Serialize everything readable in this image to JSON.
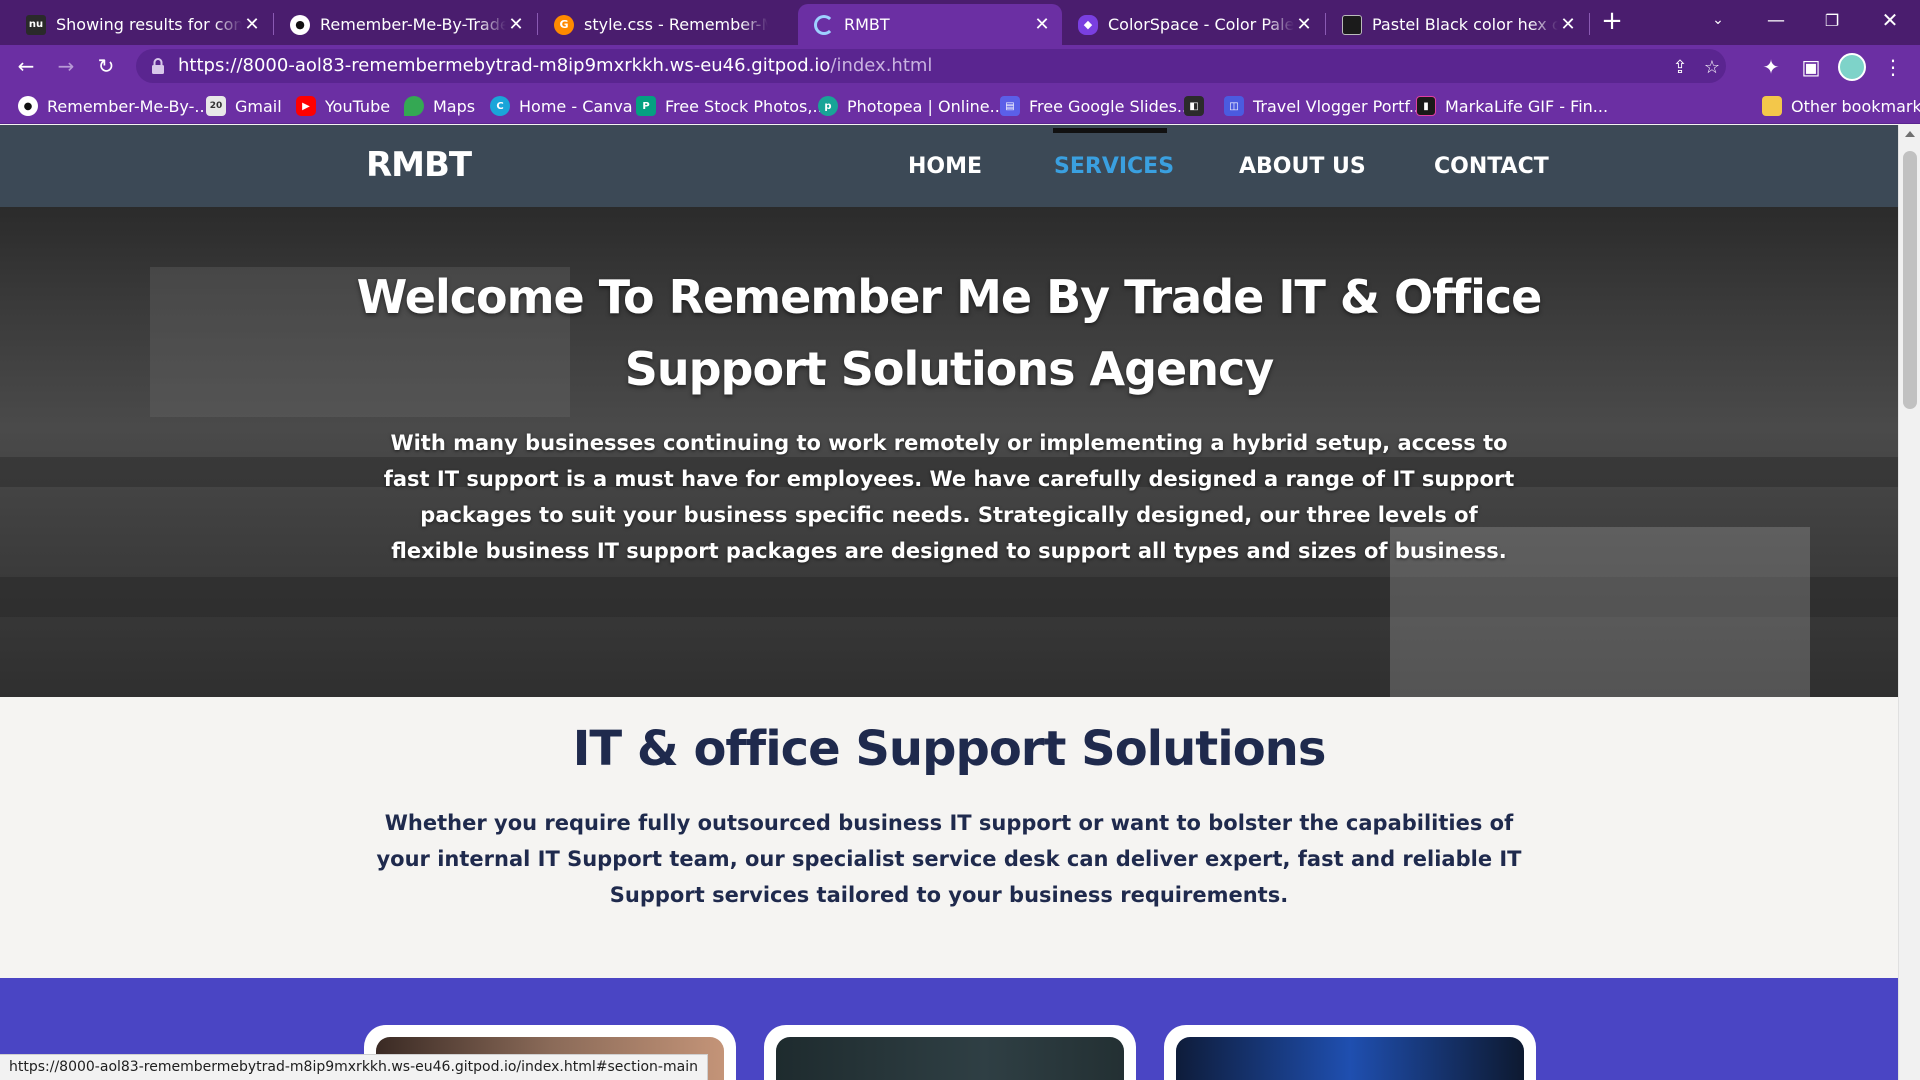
{
  "browser": {
    "tabs": [
      {
        "title": "Showing results for content",
        "favicon": "nu"
      },
      {
        "title": "Remember-Me-By-Trade/index",
        "favicon": "github-icon"
      },
      {
        "title": "style.css - Remember-Me-By",
        "favicon": "gitpod-icon"
      },
      {
        "title": "RMBT",
        "favicon": "loading-icon"
      },
      {
        "title": "ColorSpace - Color Palettes",
        "favicon": "colorspace-icon"
      },
      {
        "title": "Pastel Black color hex code",
        "favicon": "colorhex-icon"
      }
    ],
    "active_tab_index": 3,
    "url_host": "https://8000-aol83-remembermebytrad-m8ip9mxrkkh.ws-eu46.gitpod.io",
    "url_path": "/index.html",
    "bookmarks": [
      {
        "label": "Remember-Me-By-...",
        "icon": "github-icon"
      },
      {
        "label": "Gmail",
        "icon": "calendar-icon"
      },
      {
        "label": "YouTube",
        "icon": "youtube-icon"
      },
      {
        "label": "Maps",
        "icon": "maps-icon"
      },
      {
        "label": "Home - Canva",
        "icon": "canva-icon"
      },
      {
        "label": "Free Stock Photos,...",
        "icon": "stock-photos-icon"
      },
      {
        "label": "Photopea | Online...",
        "icon": "photopea-icon"
      },
      {
        "label": "Free Google Slides...",
        "icon": "slides-icon"
      },
      {
        "label": "",
        "icon": "bookmark-cube-icon"
      },
      {
        "label": "Travel Vlogger Portf...",
        "icon": "portfolio-icon"
      },
      {
        "label": "MarkaLife GIF - Fin...",
        "icon": "gif-icon"
      }
    ],
    "other_bookmarks": "Other bookmarks",
    "status_url": "https://8000-aol83-remembermebytrad-m8ip9mxrkkh.ws-eu46.gitpod.io/index.html#section-main"
  },
  "site": {
    "logo": "RMBT",
    "nav": [
      {
        "label": "HOME",
        "active": false
      },
      {
        "label": "SERVICES",
        "active": true
      },
      {
        "label": "ABOUT US",
        "active": false
      },
      {
        "label": "CONTACT",
        "active": false
      }
    ],
    "hero": {
      "title": "Welcome To Remember Me By Trade IT & Office Support Solutions Agency",
      "text": "With many businesses continuing to work remotely or implementing a hybrid setup, access to fast IT support is a must have for employees. We have carefully designed a range of IT support packages to suit your business specific needs. Strategically designed, our three levels of flexible business IT support packages are designed to support all types and sizes of business."
    },
    "section": {
      "title": "IT & office Support Solutions",
      "text": "Whether you require fully outsourced business IT support or want to bolster the capabilities of your internal IT Support team, our specialist service desk can deliver expert, fast and reliable IT Support services tailored to your business requirements."
    }
  },
  "colors": {
    "tab_bar": "#4a1d6e",
    "toolbar": "#6b2fa3",
    "site_header": "#3c4956",
    "nav_active": "#3aa0e0",
    "heading_text": "#1f2a4d",
    "cards_band": "#4a45c4"
  }
}
